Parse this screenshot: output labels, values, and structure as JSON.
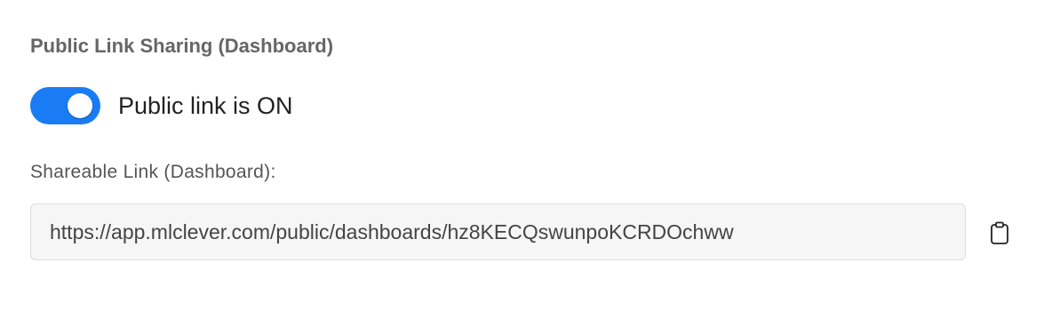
{
  "section": {
    "title": "Public Link Sharing (Dashboard)"
  },
  "public_link": {
    "toggle_on": true,
    "status_label": "Public link is ON",
    "toggle_color": "#1a7cf5"
  },
  "shareable_link": {
    "label": "Shareable Link (Dashboard):",
    "value": "https://app.mlclever.com/public/dashboards/hz8KECQswunpoKCRDOchww",
    "copy_icon": "clipboard-icon"
  }
}
